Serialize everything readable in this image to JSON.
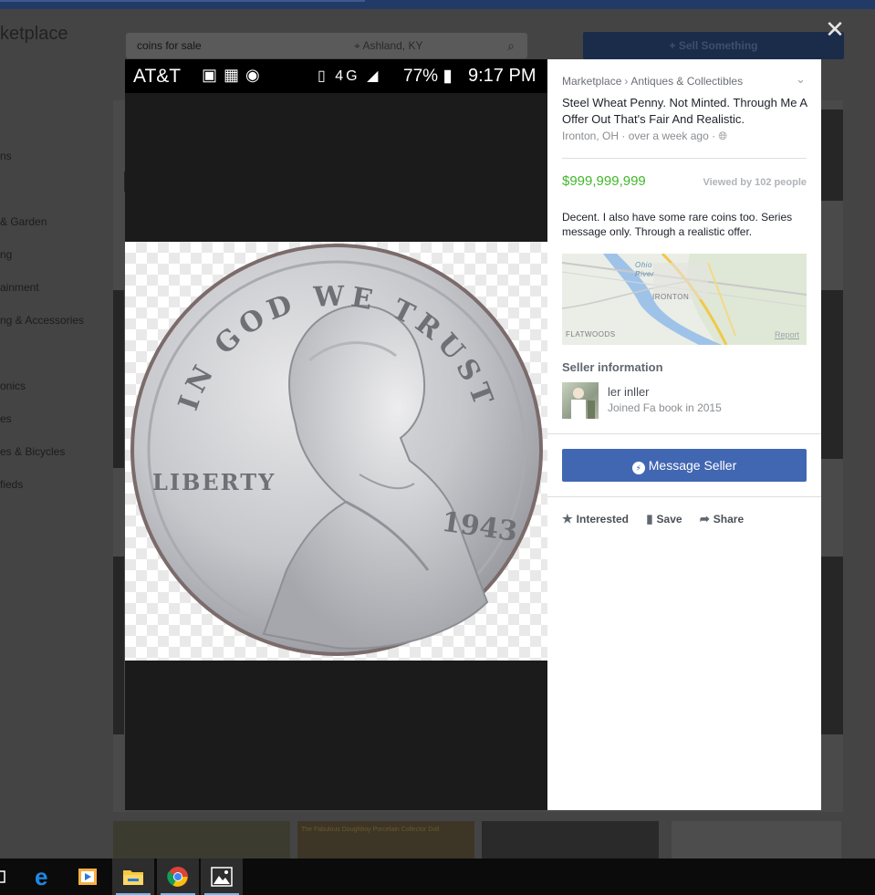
{
  "background": {
    "title": "ketplace",
    "search_value": "coins for sale",
    "location_value": "Ashland, KY",
    "sell_button": "+ Sell Something",
    "categories": [
      "ns",
      "& Garden",
      "ng",
      "ainment",
      "ng & Accessories",
      "",
      "onics",
      "es",
      "es & Bicycles",
      "fieds"
    ],
    "thumb_text": "The Fabulous Doughboy Porcelain Collector Doll"
  },
  "close_label": "✕",
  "phone_status": {
    "carrier": "AT&T",
    "network": "4G",
    "battery": "77%",
    "time": "9:17 PM"
  },
  "listing": {
    "breadcrumb": [
      "Marketplace",
      "Antiques & Collectibles"
    ],
    "title": "Steel Wheat Penny. Not Minted. Through Me A Offer Out That's Fair And Realistic.",
    "meta": "Ironton, OH · over a week ago ·",
    "price": "$999,999,999",
    "views": "Viewed by 102 people",
    "description": "Decent. I also have some rare coins too. Series message only. Through a realistic offer.",
    "map": {
      "labels": [
        "Ohio River",
        "IRONTON",
        "FLATWOODS"
      ],
      "report": "Report"
    },
    "coin_text": {
      "motto": "IN GOD WE TRUST",
      "liberty": "LIBERTY",
      "year": "1943"
    }
  },
  "seller": {
    "heading": "Seller information",
    "name": "ler inller",
    "joined": "Joined Fa book in 2015"
  },
  "actions": {
    "message": "Message Seller",
    "interested": "Interested",
    "save": "Save",
    "share": "Share"
  },
  "taskbar": {
    "items": [
      "task-view",
      "edge",
      "media-player",
      "file-explorer",
      "chrome",
      "photos"
    ]
  },
  "colors": {
    "price_green": "#42b72a",
    "facebook_blue": "#4267b2"
  }
}
